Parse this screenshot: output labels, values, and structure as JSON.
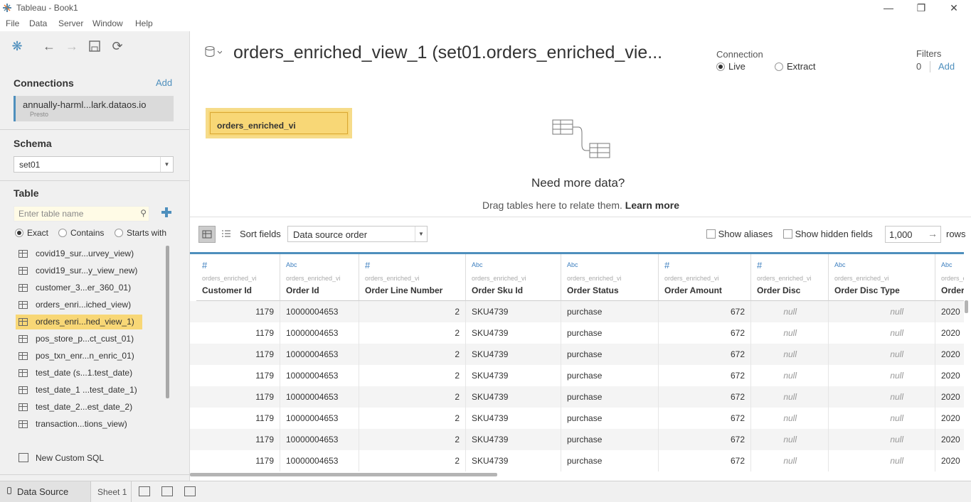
{
  "window": {
    "title": "Tableau - Book1"
  },
  "menu": [
    "File",
    "Data",
    "Server",
    "Window",
    "Help"
  ],
  "left": {
    "connections_title": "Connections",
    "add_label": "Add",
    "connection": {
      "name": "annually-harml...lark.dataos.io",
      "type": "Presto"
    },
    "schema_title": "Schema",
    "schema_value": "set01",
    "table_title": "Table",
    "search_placeholder": "Enter table name",
    "radio": {
      "exact": "Exact",
      "contains": "Contains",
      "starts": "Starts with",
      "selected": "Exact"
    },
    "tables": [
      "covid19_sur...urvey_view)",
      "covid19_sur...y_view_new)",
      "customer_3...er_360_01)",
      "orders_enri...iched_view)",
      "orders_enri...hed_view_1)",
      "pos_store_p...ct_cust_01)",
      "pos_txn_enr...n_enric_01)",
      "test_date (s...1.test_date)",
      "test_date_1 ...test_date_1)",
      "test_date_2...est_date_2)",
      "transaction...tions_view)"
    ],
    "selected_table": "orders_enri...hed_view_1)",
    "custom_sql": "New Custom SQL"
  },
  "header": {
    "datasource_name": "orders_enriched_view_1 (set01.orders_enriched_vie...",
    "connection_label": "Connection",
    "live": "Live",
    "extract": "Extract",
    "connection_selected": "Live",
    "filters_label": "Filters",
    "filters_count": "0",
    "filters_add": "Add"
  },
  "canvas": {
    "table_card": "orders_enriched_vi",
    "need_more": "Need more data?",
    "drag_text": "Drag tables here to relate them.",
    "learn_more": "Learn more"
  },
  "grid_toolbar": {
    "sort_label": "Sort fields",
    "sort_value": "Data source order",
    "show_aliases": "Show aliases",
    "show_hidden": "Show hidden fields",
    "rows_value": "1,000",
    "rows_label": "rows"
  },
  "grid": {
    "source": "orders_enriched_vi",
    "columns": [
      {
        "type": "#",
        "name": "Customer Id"
      },
      {
        "type": "Abc",
        "name": "Order Id"
      },
      {
        "type": "#",
        "name": "Order Line Number"
      },
      {
        "type": "Abc",
        "name": "Order Sku Id"
      },
      {
        "type": "Abc",
        "name": "Order Status"
      },
      {
        "type": "#",
        "name": "Order Amount"
      },
      {
        "type": "#",
        "name": "Order Disc"
      },
      {
        "type": "Abc",
        "name": "Order Disc Type"
      },
      {
        "type": "Abc",
        "name": "Order D"
      }
    ],
    "rows": [
      [
        "1179",
        "10000004653",
        "2",
        "SKU4739",
        "purchase",
        "672",
        "null",
        "null",
        "2020"
      ],
      [
        "1179",
        "10000004653",
        "2",
        "SKU4739",
        "purchase",
        "672",
        "null",
        "null",
        "2020"
      ],
      [
        "1179",
        "10000004653",
        "2",
        "SKU4739",
        "purchase",
        "672",
        "null",
        "null",
        "2020"
      ],
      [
        "1179",
        "10000004653",
        "2",
        "SKU4739",
        "purchase",
        "672",
        "null",
        "null",
        "2020"
      ],
      [
        "1179",
        "10000004653",
        "2",
        "SKU4739",
        "purchase",
        "672",
        "null",
        "null",
        "2020"
      ],
      [
        "1179",
        "10000004653",
        "2",
        "SKU4739",
        "purchase",
        "672",
        "null",
        "null",
        "2020"
      ],
      [
        "1179",
        "10000004653",
        "2",
        "SKU4739",
        "purchase",
        "672",
        "null",
        "null",
        "2020"
      ],
      [
        "1179",
        "10000004653",
        "2",
        "SKU4739",
        "purchase",
        "672",
        "null",
        "null",
        "2020"
      ]
    ]
  },
  "tabs": {
    "data_source": "Data Source",
    "sheet": "Sheet 1"
  },
  "colors": {
    "accent": "#4e8fbd",
    "highlight": "#f8d776",
    "link": "#4e8fbd"
  }
}
